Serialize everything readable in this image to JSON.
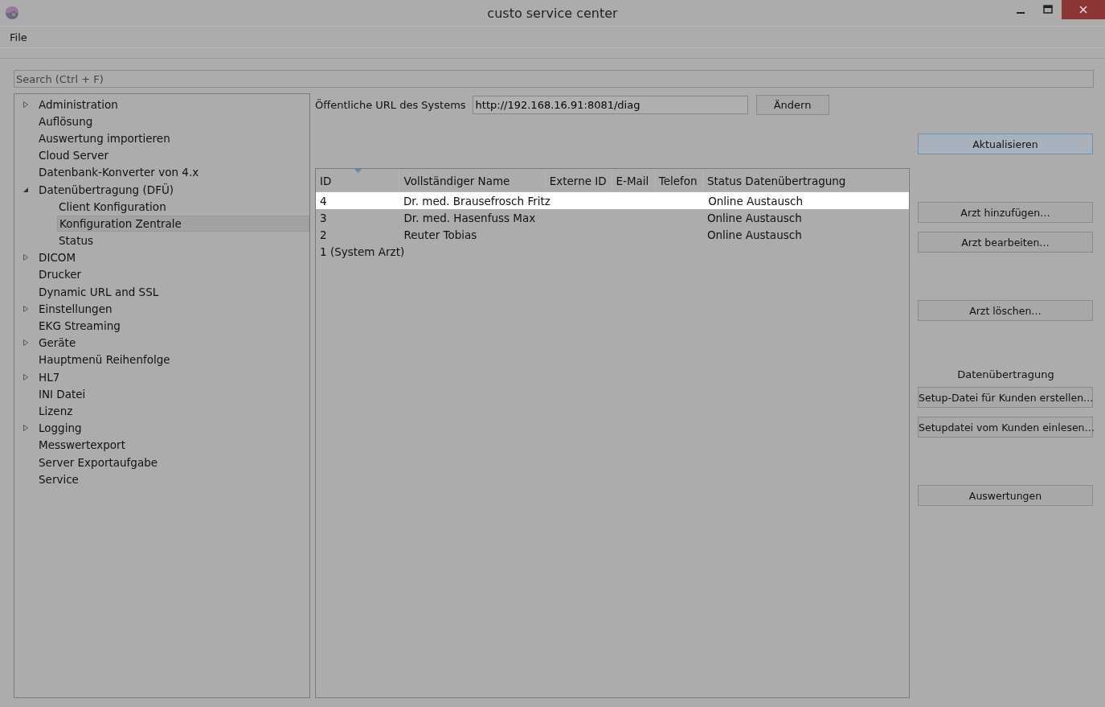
{
  "window": {
    "title": "custo service center"
  },
  "menu": [
    "File"
  ],
  "search": {
    "placeholder": "Search (Ctrl + F)"
  },
  "tree": [
    {
      "label": "Administration",
      "kind": "branch",
      "expanded": false,
      "selected": false
    },
    {
      "label": "Auflösung",
      "kind": "leaf",
      "selected": false
    },
    {
      "label": "Auswertung importieren",
      "kind": "leaf",
      "selected": false
    },
    {
      "label": "Cloud Server",
      "kind": "leaf",
      "selected": false
    },
    {
      "label": "Datenbank-Konverter von 4.x",
      "kind": "leaf",
      "selected": false
    },
    {
      "label": "Datenübertragung (DFÜ)",
      "kind": "branch",
      "expanded": true,
      "selected": false,
      "children": [
        {
          "label": "Client Konfiguration",
          "selected": false
        },
        {
          "label": "Konfiguration Zentrale",
          "selected": true
        },
        {
          "label": "Status",
          "selected": false
        }
      ]
    },
    {
      "label": "DICOM",
      "kind": "branch",
      "expanded": false,
      "selected": false
    },
    {
      "label": "Drucker",
      "kind": "leaf",
      "selected": false
    },
    {
      "label": "Dynamic URL and SSL",
      "kind": "leaf",
      "selected": false
    },
    {
      "label": "Einstellungen",
      "kind": "branch",
      "expanded": false,
      "selected": false
    },
    {
      "label": "EKG Streaming",
      "kind": "leaf",
      "selected": false
    },
    {
      "label": "Geräte",
      "kind": "branch",
      "expanded": false,
      "selected": false
    },
    {
      "label": "Hauptmenü Reihenfolge",
      "kind": "leaf",
      "selected": false
    },
    {
      "label": "HL7",
      "kind": "branch",
      "expanded": false,
      "selected": false
    },
    {
      "label": "INI Datei",
      "kind": "leaf",
      "selected": false
    },
    {
      "label": "Lizenz",
      "kind": "leaf",
      "selected": false
    },
    {
      "label": "Logging",
      "kind": "branch",
      "expanded": false,
      "selected": false
    },
    {
      "label": "Messwertexport",
      "kind": "leaf",
      "selected": false
    },
    {
      "label": "Server Exportaufgabe",
      "kind": "leaf",
      "selected": false
    },
    {
      "label": "Service",
      "kind": "leaf",
      "selected": false
    }
  ],
  "url_field": {
    "label": "Öffentliche URL des Systems",
    "value": "http://192.168.16.91:8081/diag",
    "button": "Ändern"
  },
  "table": {
    "columns": [
      {
        "label": "ID",
        "sorted": true
      },
      {
        "label": "Vollständiger Name",
        "sorted": false
      },
      {
        "label": "Externe ID",
        "sorted": false
      },
      {
        "label": "E-Mail",
        "sorted": false
      },
      {
        "label": "Telefon",
        "sorted": false
      },
      {
        "label": "Status Datenübertragung",
        "sorted": false
      }
    ],
    "rows": [
      {
        "cells": [
          "4",
          "Dr. med. Brausefrosch Fritz",
          "",
          "",
          "",
          "Online Austausch"
        ],
        "selected": true
      },
      {
        "cells": [
          "3",
          "Dr. med. Hasenfuss Max",
          "",
          "",
          "",
          "Online Austausch"
        ],
        "selected": false
      },
      {
        "cells": [
          "2",
          "Reuter Tobias",
          "",
          "",
          "",
          "Online Austausch"
        ],
        "selected": false
      },
      {
        "cells": [
          "1 (System Arzt)",
          "",
          "",
          "",
          "",
          ""
        ],
        "selected": false
      }
    ]
  },
  "button_groups": [
    {
      "buttons": [
        {
          "label": "Aktualisieren",
          "focused": true
        }
      ]
    },
    {
      "buttons": [
        {
          "label": "Arzt hinzufügen…",
          "focused": false
        },
        {
          "label": "Arzt bearbeiten…",
          "focused": false
        }
      ]
    },
    {
      "buttons": [
        {
          "label": "Arzt löschen…",
          "focused": false
        }
      ]
    },
    {
      "heading": "Datenübertragung",
      "buttons": [
        {
          "label": "Setup-Datei für Kunden erstellen…",
          "focused": false
        },
        {
          "label": "Setupdatei vom Kunden einlesen…",
          "focused": false
        }
      ]
    },
    {
      "buttons": [
        {
          "label": "Auswertungen",
          "focused": false
        }
      ]
    }
  ]
}
